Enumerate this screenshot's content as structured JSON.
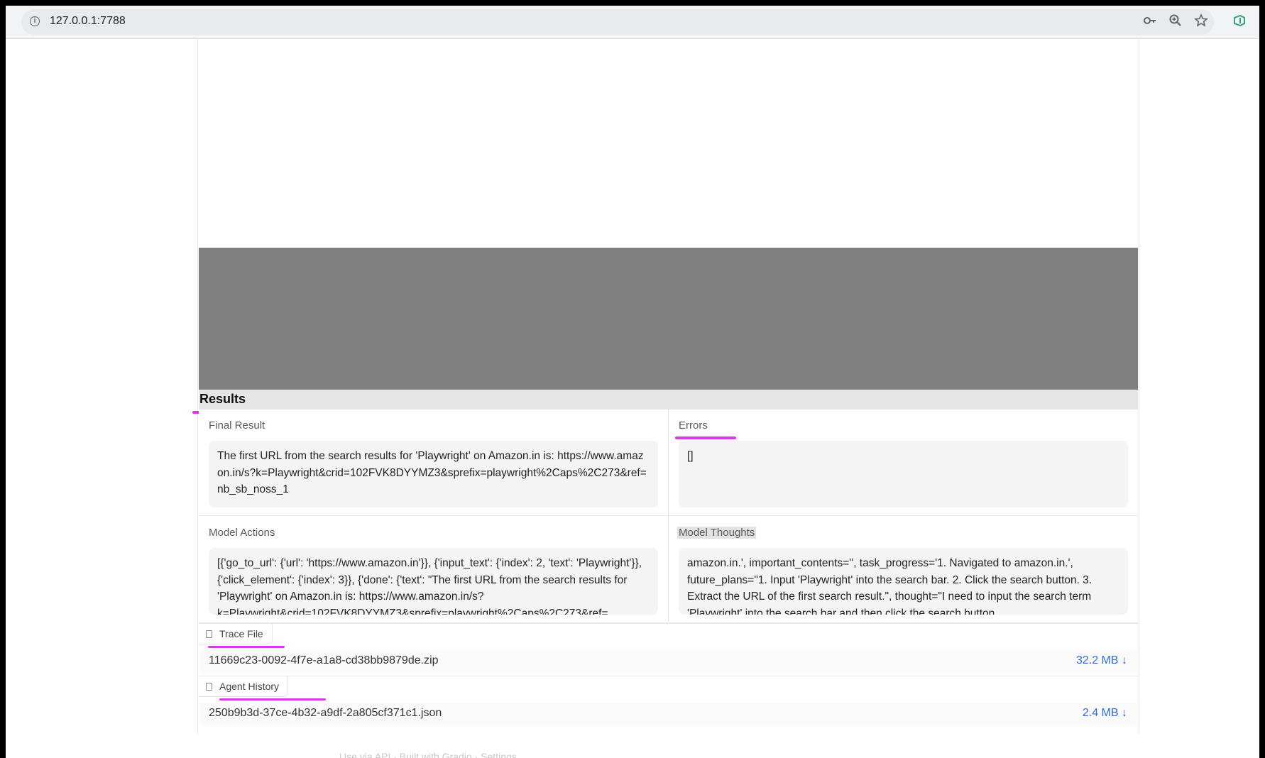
{
  "browser": {
    "url": "127.0.0.1:7788",
    "icons": [
      "info-icon",
      "key-icon",
      "zoom-icon",
      "star-icon",
      "extension-icon"
    ]
  },
  "results": {
    "title": "Results",
    "final_result": {
      "label": "Final Result",
      "text": "The first URL from the search results for 'Playwright' on Amazon.in is: https://www.amazon.in/s?k=Playwright&crid=102FVK8DYYMZ3&sprefix=playwright%2Caps%2C273&ref=nb_sb_noss_1"
    },
    "errors": {
      "label": "Errors",
      "text": "[]"
    },
    "model_actions": {
      "label": "Model Actions",
      "text": "[{'go_to_url': {'url': 'https://www.amazon.in'}}, {'input_text': {'index': 2, 'text': 'Playwright'}}, {'click_element': {'index': 3}}, {'done': {'text': \"The first URL from the search results for 'Playwright' on Amazon.in is: https://www.amazon.in/s?k=Playwright&crid=102FVK8DYYMZ3&sprefix=playwright%2Caps%2C273&ref="
    },
    "model_thoughts": {
      "label": "Model Thoughts",
      "text": "amazon.in.', important_contents='', task_progress='1. Navigated to amazon.in.', future_plans=\"1. Input 'Playwright' into the search bar. 2. Click the search button. 3. Extract the URL of the first search result.\", thought=\"I need to input the search term 'Playwright' into the search bar and then click the search button."
    }
  },
  "files": [
    {
      "tag": "Trace File",
      "name": "11669c23-0092-4f7e-a1a8-cd38bb9879de.zip",
      "size": "32.2 MB ↓"
    },
    {
      "tag": "Agent History",
      "name": "250b9b3d-37ce-4b32-a9df-2a805cf371c1.json",
      "size": "2.4 MB ↓"
    }
  ],
  "footer": {
    "text": "Use via API  ·  Built with Gradio  ·  Settings"
  },
  "colors": {
    "highlight": "#d63be6",
    "link": "#2f6fd6",
    "placeholder": "#808080"
  }
}
